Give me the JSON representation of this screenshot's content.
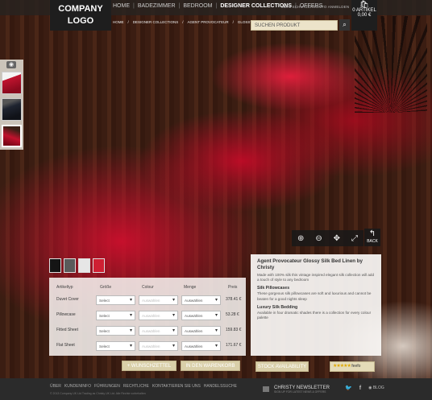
{
  "brand": {
    "logo_line1": "COMPANY",
    "logo_line2": "LOGO"
  },
  "nav": {
    "items": [
      "HOME",
      "BADEZIMMER",
      "BEDROOM",
      "DESIGNER COLLECTIONS",
      "OFFERS"
    ],
    "active": "DESIGNER COLLECTIONS",
    "account_link": "MEIN SCHUTZERKONTO ANMELDEN"
  },
  "cart": {
    "icon": "basket-icon",
    "count_label": "0 ARTIKEL",
    "total": "0,00 €"
  },
  "breadcrumb": [
    "HOME",
    "DESIGNER COLLECTIONS",
    "AGENT PROVOCATEUR",
    "GLOSSY SILK"
  ],
  "search": {
    "placeholder": "SUCHEN PRODUKT",
    "icon": "search-icon"
  },
  "gallery": {
    "icon": "camera-icon",
    "thumbs": [
      "red-bedding",
      "dark-bedding",
      "red-bedding-detail"
    ]
  },
  "viewer_tools": {
    "icons": [
      "zoom-in-icon",
      "zoom-out-icon",
      "pan-arrows-icon",
      "fullscreen-icon"
    ],
    "back_label": "BACK"
  },
  "product": {
    "title": "Agent Provocateur Glossy Silk Bed Linen by Christy",
    "intro": "Made with 100% silk this vintage inspired elegant silk collection will add a touch of style to any bedroom",
    "sections": [
      {
        "heading": "Silk Pillowcases",
        "text": "These gorgeous silk pillowcases are soft and luxurious and cannot be beaten for a good nights sleep"
      },
      {
        "heading": "Luxury Silk Bedding",
        "text": "Available in four dramatic shades there is a collection for every colour palette"
      }
    ]
  },
  "swatches": [
    "#151515",
    "#5a5a5a",
    "#e6e6e6",
    "#cf2033"
  ],
  "order_table": {
    "headers": [
      "Artikeltyp",
      "Größe",
      "Colour",
      "Menge",
      "Preis"
    ],
    "rows": [
      {
        "item": "Duvet Cover",
        "size": "Select",
        "colour": "Auswählen",
        "qty": "Auswählen",
        "price": "378.41 €"
      },
      {
        "item": "Pillowcase",
        "size": "Select",
        "colour": "Auswählen",
        "qty": "Auswählen",
        "price": "53.28 €"
      },
      {
        "item": "Fitted Sheet",
        "size": "Select",
        "colour": "Auswählen",
        "qty": "Auswählen",
        "price": "159.83 €"
      },
      {
        "item": "Flat Sheet",
        "size": "Select",
        "colour": "Auswählen",
        "qty": "Auswählen",
        "price": "171.67 €"
      }
    ]
  },
  "actions": {
    "wishlist": "+ WUNSCHZETTEL",
    "add_to_cart": "IN DEN WARENKORB",
    "stock": "STOCK AVAILABILITY",
    "rating_brand": "feefo"
  },
  "footer": {
    "links": [
      "ÜBER",
      "KUNDENINFO",
      "FÜHRUNGEN",
      "RECHTLICHE",
      "KONTAKTIEREN SIE UNS",
      "HANDELSSUCHE"
    ],
    "copyright": "© 2013 Company UK Ltd Trading as Christy UK Ltd. Alle Rechte vorbehalten",
    "newsletter": "CHRISTY NEWSLETTER",
    "newsletter_sub": "SIGN UP FOR LATEST NEWS & OFFERS",
    "social": [
      "twitter-icon",
      "facebook-icon"
    ],
    "blog": "BLOG"
  }
}
